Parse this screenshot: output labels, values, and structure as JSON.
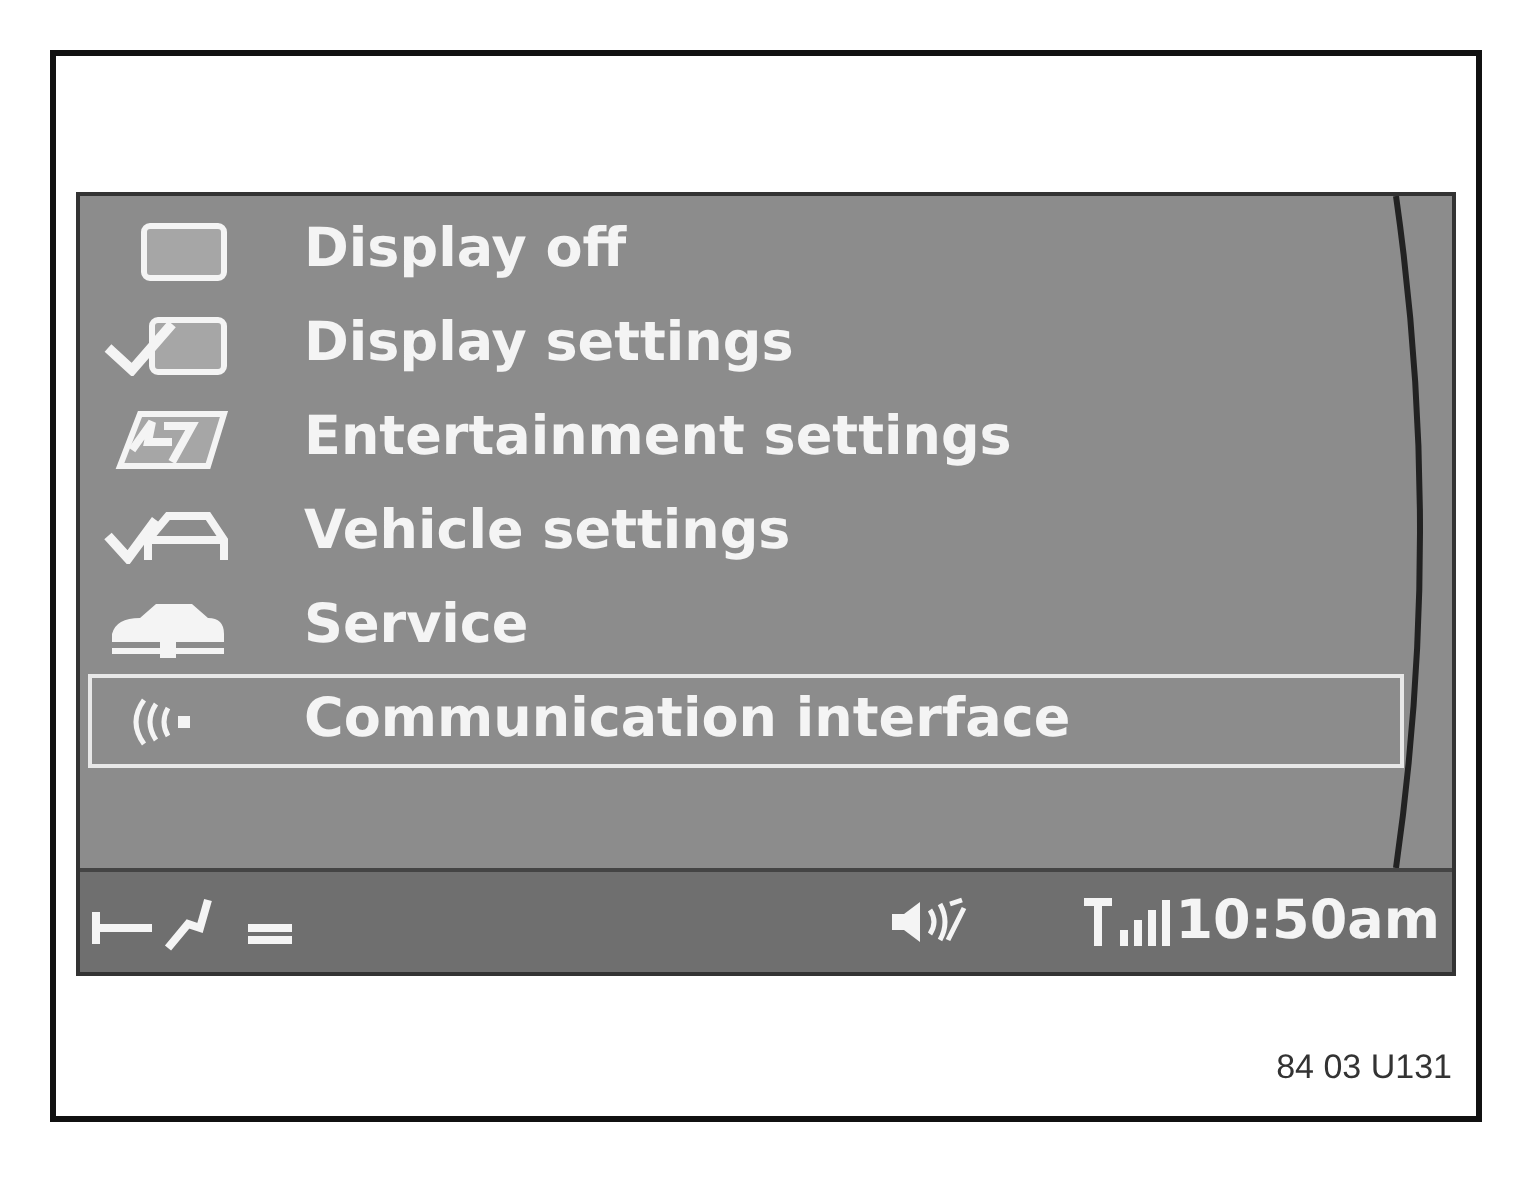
{
  "menu": {
    "items": [
      {
        "label": "Display off",
        "kind": "screen",
        "selected": false
      },
      {
        "label": "Display settings",
        "kind": "check",
        "selected": false
      },
      {
        "label": "Entertainment settings",
        "kind": "entertainment",
        "selected": false
      },
      {
        "label": "Vehicle settings",
        "kind": "vehicle",
        "selected": false
      },
      {
        "label": "Service",
        "kind": "service",
        "selected": false
      },
      {
        "label": "Communication interface",
        "kind": "antenna",
        "selected": true
      }
    ]
  },
  "status_bar": {
    "time": "10:50am"
  },
  "figure_code": "84 03 U131"
}
